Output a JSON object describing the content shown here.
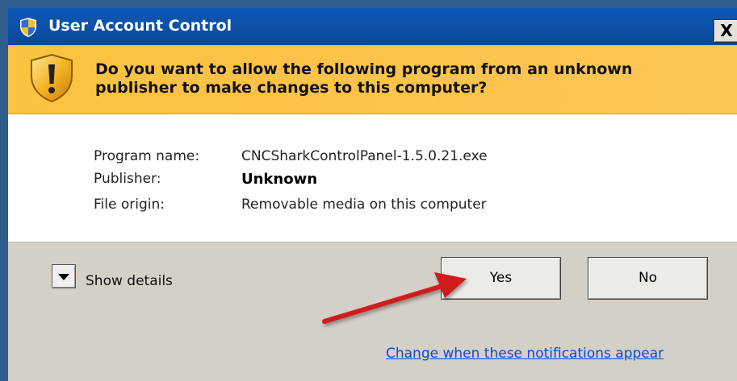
{
  "window": {
    "title": "User Account Control",
    "close_label": "✕",
    "close_glyph": "X"
  },
  "warning": {
    "heading_line1": "Do you want to allow the following program from an unknown",
    "heading_line2": "publisher to make changes to this computer?",
    "band_color": "#fdc247"
  },
  "details": {
    "program_label": "Program name:",
    "program_value": "CNCSharkControlPanel-1.5.0.21.exe",
    "publisher_label": "Publisher:",
    "publisher_value": "Unknown",
    "origin_label": "File origin:",
    "origin_value": "Removable media on this computer"
  },
  "footer": {
    "show_details_label": "Show details",
    "yes_label": "Yes",
    "no_label": "No",
    "link_text": "Change when these notifications appear"
  },
  "annotation": {
    "arrow_color": "#d01f1f"
  }
}
